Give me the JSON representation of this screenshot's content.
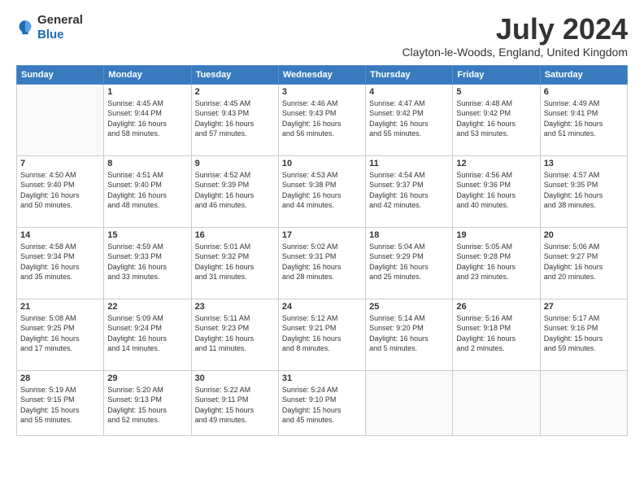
{
  "header": {
    "logo": {
      "general": "General",
      "blue": "Blue"
    },
    "title": "July 2024",
    "location": "Clayton-le-Woods, England, United Kingdom"
  },
  "weekdays": [
    "Sunday",
    "Monday",
    "Tuesday",
    "Wednesday",
    "Thursday",
    "Friday",
    "Saturday"
  ],
  "weeks": [
    [
      {
        "day": "",
        "info": ""
      },
      {
        "day": "1",
        "info": "Sunrise: 4:45 AM\nSunset: 9:44 PM\nDaylight: 16 hours\nand 58 minutes."
      },
      {
        "day": "2",
        "info": "Sunrise: 4:45 AM\nSunset: 9:43 PM\nDaylight: 16 hours\nand 57 minutes."
      },
      {
        "day": "3",
        "info": "Sunrise: 4:46 AM\nSunset: 9:43 PM\nDaylight: 16 hours\nand 56 minutes."
      },
      {
        "day": "4",
        "info": "Sunrise: 4:47 AM\nSunset: 9:42 PM\nDaylight: 16 hours\nand 55 minutes."
      },
      {
        "day": "5",
        "info": "Sunrise: 4:48 AM\nSunset: 9:42 PM\nDaylight: 16 hours\nand 53 minutes."
      },
      {
        "day": "6",
        "info": "Sunrise: 4:49 AM\nSunset: 9:41 PM\nDaylight: 16 hours\nand 51 minutes."
      }
    ],
    [
      {
        "day": "7",
        "info": "Sunrise: 4:50 AM\nSunset: 9:40 PM\nDaylight: 16 hours\nand 50 minutes."
      },
      {
        "day": "8",
        "info": "Sunrise: 4:51 AM\nSunset: 9:40 PM\nDaylight: 16 hours\nand 48 minutes."
      },
      {
        "day": "9",
        "info": "Sunrise: 4:52 AM\nSunset: 9:39 PM\nDaylight: 16 hours\nand 46 minutes."
      },
      {
        "day": "10",
        "info": "Sunrise: 4:53 AM\nSunset: 9:38 PM\nDaylight: 16 hours\nand 44 minutes."
      },
      {
        "day": "11",
        "info": "Sunrise: 4:54 AM\nSunset: 9:37 PM\nDaylight: 16 hours\nand 42 minutes."
      },
      {
        "day": "12",
        "info": "Sunrise: 4:56 AM\nSunset: 9:36 PM\nDaylight: 16 hours\nand 40 minutes."
      },
      {
        "day": "13",
        "info": "Sunrise: 4:57 AM\nSunset: 9:35 PM\nDaylight: 16 hours\nand 38 minutes."
      }
    ],
    [
      {
        "day": "14",
        "info": "Sunrise: 4:58 AM\nSunset: 9:34 PM\nDaylight: 16 hours\nand 35 minutes."
      },
      {
        "day": "15",
        "info": "Sunrise: 4:59 AM\nSunset: 9:33 PM\nDaylight: 16 hours\nand 33 minutes."
      },
      {
        "day": "16",
        "info": "Sunrise: 5:01 AM\nSunset: 9:32 PM\nDaylight: 16 hours\nand 31 minutes."
      },
      {
        "day": "17",
        "info": "Sunrise: 5:02 AM\nSunset: 9:31 PM\nDaylight: 16 hours\nand 28 minutes."
      },
      {
        "day": "18",
        "info": "Sunrise: 5:04 AM\nSunset: 9:29 PM\nDaylight: 16 hours\nand 25 minutes."
      },
      {
        "day": "19",
        "info": "Sunrise: 5:05 AM\nSunset: 9:28 PM\nDaylight: 16 hours\nand 23 minutes."
      },
      {
        "day": "20",
        "info": "Sunrise: 5:06 AM\nSunset: 9:27 PM\nDaylight: 16 hours\nand 20 minutes."
      }
    ],
    [
      {
        "day": "21",
        "info": "Sunrise: 5:08 AM\nSunset: 9:25 PM\nDaylight: 16 hours\nand 17 minutes."
      },
      {
        "day": "22",
        "info": "Sunrise: 5:09 AM\nSunset: 9:24 PM\nDaylight: 16 hours\nand 14 minutes."
      },
      {
        "day": "23",
        "info": "Sunrise: 5:11 AM\nSunset: 9:23 PM\nDaylight: 16 hours\nand 11 minutes."
      },
      {
        "day": "24",
        "info": "Sunrise: 5:12 AM\nSunset: 9:21 PM\nDaylight: 16 hours\nand 8 minutes."
      },
      {
        "day": "25",
        "info": "Sunrise: 5:14 AM\nSunset: 9:20 PM\nDaylight: 16 hours\nand 5 minutes."
      },
      {
        "day": "26",
        "info": "Sunrise: 5:16 AM\nSunset: 9:18 PM\nDaylight: 16 hours\nand 2 minutes."
      },
      {
        "day": "27",
        "info": "Sunrise: 5:17 AM\nSunset: 9:16 PM\nDaylight: 15 hours\nand 59 minutes."
      }
    ],
    [
      {
        "day": "28",
        "info": "Sunrise: 5:19 AM\nSunset: 9:15 PM\nDaylight: 15 hours\nand 55 minutes."
      },
      {
        "day": "29",
        "info": "Sunrise: 5:20 AM\nSunset: 9:13 PM\nDaylight: 15 hours\nand 52 minutes."
      },
      {
        "day": "30",
        "info": "Sunrise: 5:22 AM\nSunset: 9:11 PM\nDaylight: 15 hours\nand 49 minutes."
      },
      {
        "day": "31",
        "info": "Sunrise: 5:24 AM\nSunset: 9:10 PM\nDaylight: 15 hours\nand 45 minutes."
      },
      {
        "day": "",
        "info": ""
      },
      {
        "day": "",
        "info": ""
      },
      {
        "day": "",
        "info": ""
      }
    ]
  ]
}
